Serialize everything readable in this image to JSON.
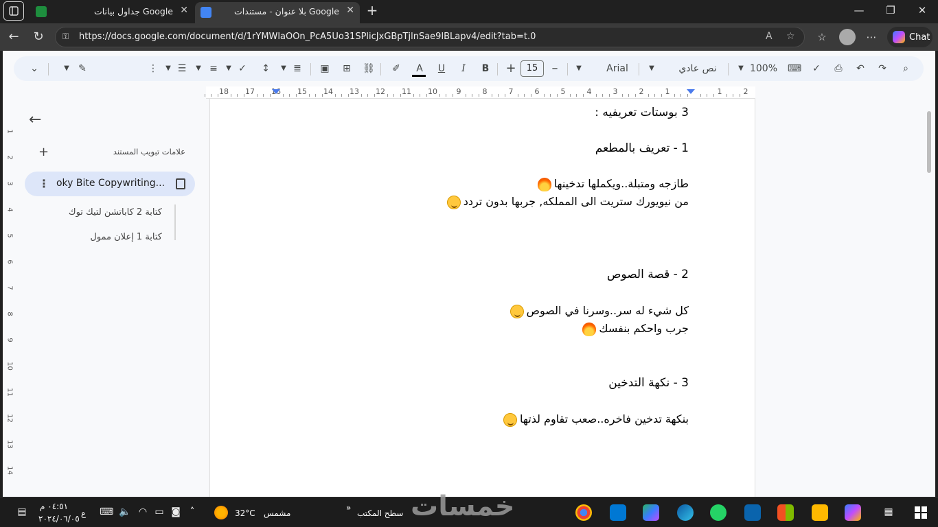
{
  "browser": {
    "tabs": [
      {
        "title": "جداول بيانات Google",
        "close": "✕"
      },
      {
        "title": "بلا عنوان - مستندات Google",
        "close": "✕"
      }
    ],
    "new_tab": "+",
    "window": {
      "minimize": "—",
      "maximize": "❐",
      "close": "✕"
    },
    "url": "https://docs.google.com/document/d/1rYMWlaOOn_PcA5Uo31SPlicJxGBpTjlnSae9lBLapv4/edit?tab=t.0",
    "chat_label": "Chat"
  },
  "toolbar": {
    "zoom": "100%",
    "style": "نص عادي",
    "font": "Arial",
    "font_size": "15",
    "minus": "–",
    "plus": "+",
    "bold": "B",
    "italic": "I",
    "underline": "U",
    "color_a": "A"
  },
  "ruler": {
    "labels": [
      "2",
      "1",
      "",
      "1",
      "2",
      "3",
      "4",
      "5",
      "6",
      "7",
      "8",
      "9",
      "10",
      "11",
      "12",
      "13",
      "14",
      "15",
      "16",
      "17",
      "18"
    ]
  },
  "vruler": {
    "labels": [
      "1",
      "2",
      "3",
      "4",
      "5",
      "6",
      "7",
      "8",
      "9",
      "10",
      "11",
      "12",
      "13",
      "14"
    ]
  },
  "sidebar": {
    "title": "علامات تبويب المستند",
    "add": "+",
    "active_tab": "oky Bite Copywriting...",
    "dots": "⋮",
    "items": [
      "كتابة 2 كاباتشن لتيك توك",
      "كتابة 1 إعلان ممول"
    ]
  },
  "document": {
    "lines": [
      {
        "text": "3 بوستات تعريفيه :",
        "emoji": ""
      },
      {
        "text": "1 - تعريف بالمطعم",
        "emoji": ""
      },
      {
        "text": "طازجه ومتبلة..ويكملها تدخينها",
        "emoji": "fire"
      },
      {
        "text": "من نيويورك ستريت الى المملكه, جربها بدون تردد",
        "emoji": "smile"
      },
      {
        "text": "2 - قصة الصوص",
        "emoji": ""
      },
      {
        "text": "كل شيء له سر..وسرنا في الصوص",
        "emoji": "smile"
      },
      {
        "text": "جرب واحكم بنفسك",
        "emoji": "fire"
      },
      {
        "text": "3 - نكهة التدخين",
        "emoji": ""
      },
      {
        "text": "بنكهة تدخين فاخره..صعب تقاوم لذتها",
        "emoji": "smile"
      }
    ]
  },
  "taskbar": {
    "time": "٠٤:٥١ م",
    "date": "٢٠٢٤/٠٦/٠٥",
    "lang": "ع",
    "temp": "32°C",
    "weather": "مشمس",
    "desktop": "سطح المكتب",
    "watermark": "خمسات"
  },
  "colors": {
    "accent": "#0b57d0",
    "toolbar_bg": "#edf2fa",
    "active_outline": "#dde6f9",
    "taskbar_bg": "#1c1c1c"
  }
}
